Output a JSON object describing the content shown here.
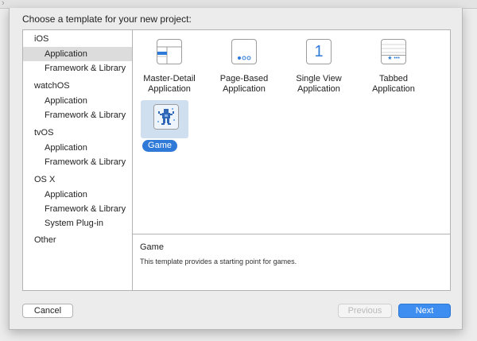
{
  "top_chevron": "›",
  "dialog": {
    "title": "Choose a template for your new project:"
  },
  "sidebar": {
    "items": [
      {
        "label": "iOS"
      },
      {
        "label": "Application"
      },
      {
        "label": "Framework & Library"
      },
      {
        "label": "watchOS"
      },
      {
        "label": "Application"
      },
      {
        "label": "Framework & Library"
      },
      {
        "label": "tvOS"
      },
      {
        "label": "Application"
      },
      {
        "label": "Framework & Library"
      },
      {
        "label": "OS X"
      },
      {
        "label": "Application"
      },
      {
        "label": "Framework & Library"
      },
      {
        "label": "System Plug-in"
      },
      {
        "label": "Other"
      }
    ],
    "selected_item": "iOS > Application"
  },
  "templates": [
    {
      "label_line1": "Master-Detail",
      "label_line2": "Application",
      "icon": "master-detail-icon"
    },
    {
      "label_line1": "Page-Based",
      "label_line2": "Application",
      "icon": "page-based-icon"
    },
    {
      "label_line1": "Single View",
      "label_line2": "Application",
      "icon": "single-view-icon",
      "icon_glyph": "1"
    },
    {
      "label_line1": "Tabbed",
      "label_line2": "Application",
      "icon": "tabbed-icon",
      "icon_glyph": "★ •••"
    },
    {
      "label": "Game",
      "icon": "game-icon",
      "selected": true
    }
  ],
  "description": {
    "title": "Game",
    "text": "This template provides a starting point for games."
  },
  "buttons": {
    "cancel": "Cancel",
    "previous": "Previous",
    "next": "Next"
  },
  "colors": {
    "accent": "#2f7ad8",
    "next_button": "#3d8ef0",
    "selection_bg": "#cfdff0",
    "sidebar_selection": "#dcdcdc"
  }
}
